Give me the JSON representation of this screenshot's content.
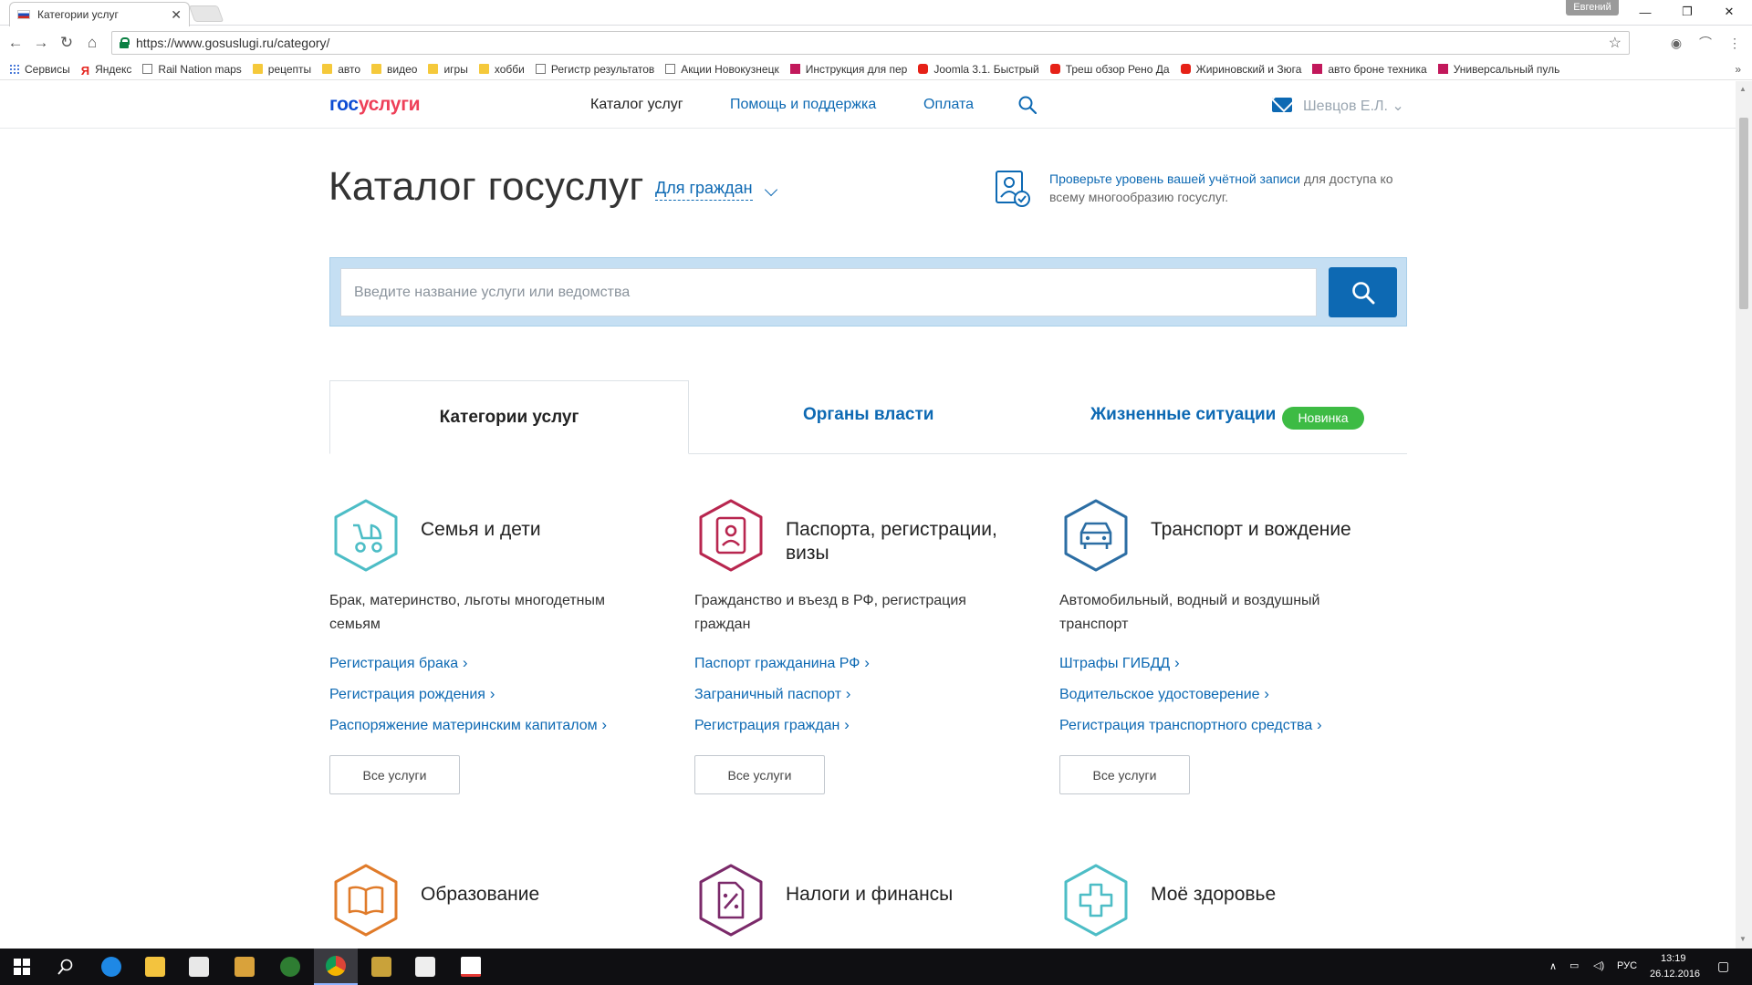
{
  "browser": {
    "tab_title": "Категории услуг",
    "profile_name": "Евгений",
    "url": "https://www.gosuslugi.ru/category/",
    "bookmarks": [
      {
        "label": "Сервисы",
        "icon": "apps-icon"
      },
      {
        "label": "Яндекс",
        "icon": "yandex-icon"
      },
      {
        "label": "Rail Nation maps",
        "icon": "page-icon"
      },
      {
        "label": "рецепты",
        "icon": "folder-icon"
      },
      {
        "label": "авто",
        "icon": "folder-icon"
      },
      {
        "label": "видео",
        "icon": "folder-icon"
      },
      {
        "label": "игры",
        "icon": "folder-icon"
      },
      {
        "label": "хобби",
        "icon": "folder-icon"
      },
      {
        "label": "Регистр результатов",
        "icon": "leaf-icon"
      },
      {
        "label": "Акции Новокузнецк",
        "icon": "house-icon"
      },
      {
        "label": "Инструкция для пер",
        "icon": "d-icon"
      },
      {
        "label": "Joomla 3.1. Быстрый",
        "icon": "youtube-icon"
      },
      {
        "label": "Треш обзор Рено Да",
        "icon": "youtube-icon"
      },
      {
        "label": "Жириновский и Зюга",
        "icon": "youtube-icon"
      },
      {
        "label": "авто броне техника",
        "icon": "d-icon"
      },
      {
        "label": "Универсальный пуль",
        "icon": "d-icon"
      }
    ]
  },
  "header": {
    "logo_part1": "гос",
    "logo_part2": "услуги",
    "nav": [
      "Каталог услуг",
      "Помощь и поддержка",
      "Оплата"
    ],
    "user_name": "Шевцов Е.Л."
  },
  "catalog": {
    "title": "Каталог госуслуг",
    "audience": "Для граждан",
    "notice_link": "Проверьте уровень вашей учётной записи",
    "notice_rest": " для доступа ко всему многообразию госуслуг."
  },
  "search": {
    "placeholder": "Введите название услуги или ведомства"
  },
  "tabs": {
    "categories": "Категории услуг",
    "authorities": "Органы власти",
    "life_situations": "Жизненные ситуации",
    "new_badge": "Новинка"
  },
  "categories": [
    {
      "title": "Семья и дети",
      "description": "Брак, материнство, льготы многодетным семьям",
      "links": [
        "Регистрация брака",
        "Регистрация рождения",
        "Распоряжение материнским капиталом"
      ],
      "all_label": "Все услуги",
      "icon": "baby-stroller-icon",
      "color": "#4dbdc6"
    },
    {
      "title": "Паспорта, регистрации, визы",
      "description": "Гражданство и въезд в РФ, регистрация граждан",
      "links": [
        "Паспорт гражданина РФ",
        "Заграничный паспорт",
        "Регистрация граждан"
      ],
      "all_label": "Все услуги",
      "icon": "passport-icon",
      "color": "#b8264f"
    },
    {
      "title": "Транспорт и вождение",
      "description": "Автомобильный, водный и воздушный транспорт",
      "links": [
        "Штрафы ГИБДД",
        "Водительское удостоверение",
        "Регистрация транспортного средства"
      ],
      "all_label": "Все услуги",
      "icon": "car-icon",
      "color": "#2c6ea4"
    },
    {
      "title": "Образование",
      "icon": "book-icon",
      "color": "#e07b2a"
    },
    {
      "title": "Налоги и финансы",
      "icon": "tax-document-icon",
      "color": "#7b2a6a"
    },
    {
      "title": "Моё здоровье",
      "icon": "medical-cross-icon",
      "color": "#4dbdc6"
    }
  ],
  "taskbar": {
    "language": "РУС",
    "time": "13:19",
    "date": "26.12.2016"
  }
}
